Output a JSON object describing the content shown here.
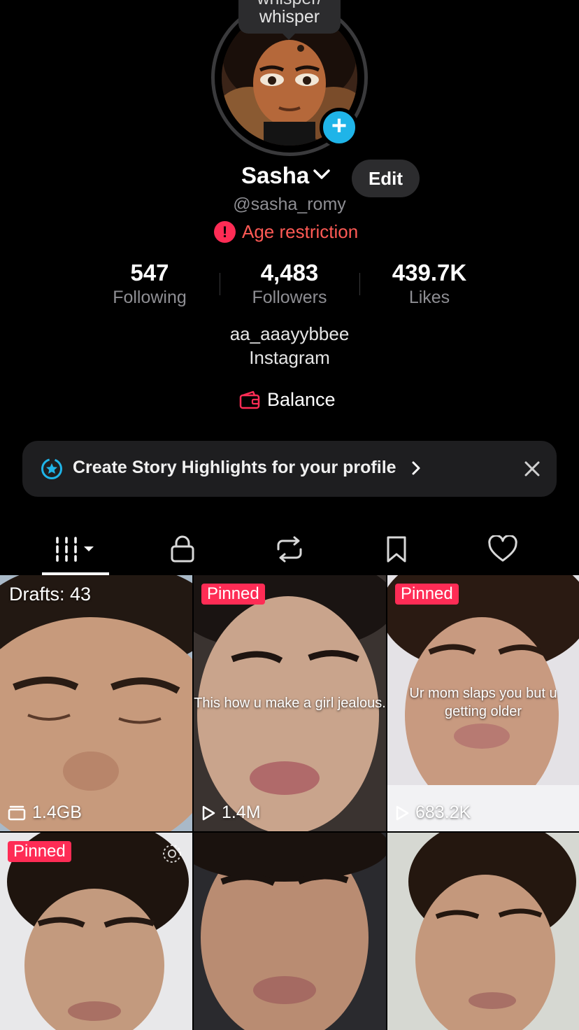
{
  "bubble": {
    "line1": "whisper/",
    "line2": "whisper"
  },
  "profile": {
    "name": "Sasha",
    "edit_label": "Edit",
    "handle": "@sasha_romy",
    "restriction": "Age restriction"
  },
  "stats": [
    {
      "value": "547",
      "label": "Following"
    },
    {
      "value": "4,483",
      "label": "Followers"
    },
    {
      "value": "439.7K",
      "label": "Likes"
    }
  ],
  "bio": {
    "line1": "aa_aaayybbee",
    "line2": "Instagram"
  },
  "balance": {
    "label": "Balance"
  },
  "banner": {
    "text": "Create Story Highlights for your profile"
  },
  "tabs": [
    {
      "icon": "grid-icon",
      "active": true
    },
    {
      "icon": "lock-icon"
    },
    {
      "icon": "repost-icon"
    },
    {
      "icon": "bookmark-icon"
    },
    {
      "icon": "heart-icon"
    }
  ],
  "videos": [
    {
      "label": "Drafts: 43",
      "bottom": "1.4GB",
      "bottom_icon": "drafts-icon"
    },
    {
      "badge": "Pinned",
      "overlay": "This how u make a girl jealous.",
      "bottom": "1.4M",
      "bottom_icon": "play-icon"
    },
    {
      "badge": "Pinned",
      "overlay": "Ur mom slaps you but u getting older",
      "bottom": "683.2K",
      "bottom_icon": "play-icon"
    },
    {
      "badge": "Pinned"
    },
    {},
    {}
  ],
  "colors": {
    "accent": "#fe2c55",
    "plus": "#1fb4e8",
    "warning_text": "#fe5a55"
  }
}
